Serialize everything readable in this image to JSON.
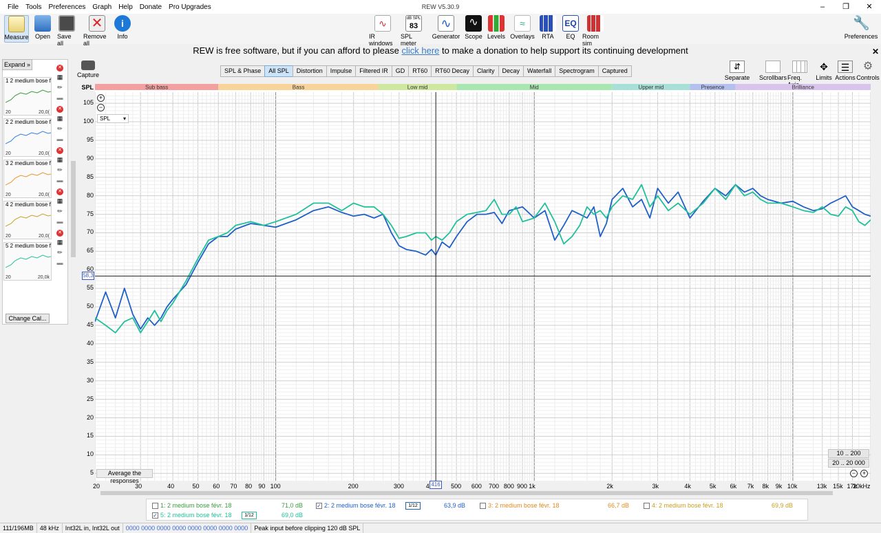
{
  "app": {
    "title": "REW V5.30.9"
  },
  "menu": [
    "File",
    "Tools",
    "Preferences",
    "Graph",
    "Help",
    "Donate",
    "Pro Upgrades"
  ],
  "toolbar_left": [
    {
      "label": "Measure",
      "icon": "measure-icon",
      "active": true
    },
    {
      "label": "Open",
      "icon": "open-folder-icon"
    },
    {
      "label": "Save all",
      "icon": "save-icon"
    },
    {
      "label": "Remove all",
      "icon": "remove-all-icon"
    },
    {
      "label": "Info",
      "icon": "info-icon"
    }
  ],
  "toolbar_center": [
    {
      "label": "IR windows",
      "icon": "ir-windows-icon"
    },
    {
      "label": "SPL meter",
      "icon": "spl-meter-icon",
      "badge_top": "dB SPL",
      "badge_value": "83"
    },
    {
      "label": "Generator",
      "icon": "generator-icon"
    },
    {
      "label": "Scope",
      "icon": "scope-icon"
    },
    {
      "label": "Levels",
      "icon": "levels-icon"
    },
    {
      "label": "Overlays",
      "icon": "overlays-icon"
    },
    {
      "label": "RTA",
      "icon": "rta-icon"
    },
    {
      "label": "EQ",
      "icon": "eq-icon"
    },
    {
      "label": "Room sim",
      "icon": "room-sim-icon"
    }
  ],
  "toolbar_right": {
    "label": "Preferences",
    "icon": "preferences-wrench-icon"
  },
  "donate": {
    "before": "REW is free software, but if you can afford to please ",
    "link": "click here",
    "after": " to make a donation to help support its continuing development"
  },
  "left_panel": {
    "expand_label": "Expand",
    "measurements": [
      {
        "label": "1 2 medium bose f",
        "axis_left": "20",
        "axis_right": "20,0(",
        "color": "#3a9a3a"
      },
      {
        "label": "2 2 medium bose f",
        "axis_left": "20",
        "axis_right": "20,0(",
        "color": "#2f7fe0"
      },
      {
        "label": "3 2 medium bose f",
        "axis_left": "20",
        "axis_right": "20,0(",
        "color": "#e8962c"
      },
      {
        "label": "4 2 medium bose f",
        "axis_left": "20",
        "axis_right": "20,0(",
        "color": "#c8a020"
      },
      {
        "label": "5 2 medium bose f",
        "axis_left": "20",
        "axis_right": "20,0k",
        "color": "#22c29a"
      }
    ],
    "change_cal_label": "Change Cal..."
  },
  "capture": {
    "label": "Capture"
  },
  "graph_tabs": [
    {
      "label": "SPL & Phase"
    },
    {
      "label": "All SPL",
      "selected": true
    },
    {
      "label": "Distortion"
    },
    {
      "label": "Impulse"
    },
    {
      "label": "Filtered IR"
    },
    {
      "label": "GD"
    },
    {
      "label": "RT60"
    },
    {
      "label": "RT60 Decay"
    },
    {
      "label": "Clarity"
    },
    {
      "label": "Decay"
    },
    {
      "label": "Waterfall"
    },
    {
      "label": "Spectrogram"
    },
    {
      "label": "Captured"
    }
  ],
  "right_tools": [
    {
      "label": "Separate",
      "icon": "separate-icon"
    },
    {
      "label": "Scrollbars",
      "icon": "scrollbars-icon"
    },
    {
      "label": "Freq. Axis",
      "icon": "freq-axis-icon"
    },
    {
      "label": "Limits",
      "icon": "limits-icon"
    },
    {
      "label": "Actions",
      "icon": "actions-icon"
    },
    {
      "label": "Controls",
      "icon": "controls-gear-icon"
    }
  ],
  "bands": [
    {
      "label": "Sub bass",
      "color": "#f2a0a0"
    },
    {
      "label": "Bass",
      "color": "#f8d49a"
    },
    {
      "label": "Low mid",
      "color": "#cfe8a0"
    },
    {
      "label": "Mid",
      "color": "#a9e6b0"
    },
    {
      "label": "Upper mid",
      "color": "#a8e0d8"
    },
    {
      "label": "Presence",
      "color": "#b4c0f0"
    },
    {
      "label": "Brilliance",
      "color": "#d8c4ec"
    }
  ],
  "plot": {
    "y_title": "SPL",
    "y_selector": "SPL",
    "cursor_y": "58,3",
    "cursor_x": "416",
    "average_button": "Average the responses",
    "range_buttons": [
      "10 .. 200",
      "20 .. 20 000"
    ]
  },
  "chart_data": {
    "type": "line",
    "xlabel": "",
    "ylabel": "SPL",
    "x_scale": "log",
    "xlim": [
      20,
      20000
    ],
    "ylim": [
      3,
      108
    ],
    "y_ticks": [
      5,
      10,
      15,
      20,
      25,
      30,
      35,
      40,
      45,
      50,
      55,
      60,
      65,
      70,
      75,
      80,
      85,
      90,
      95,
      100,
      105
    ],
    "x_tick_labels": [
      "20",
      "30",
      "40",
      "50",
      "60",
      "70",
      "80",
      "90",
      "100",
      "200",
      "300",
      "400",
      "500",
      "600",
      "700",
      "800",
      "900",
      "1k",
      "2k",
      "3k",
      "4k",
      "5k",
      "6k",
      "7k",
      "8k",
      "9k",
      "10k",
      "13k",
      "15k",
      "17k",
      "20kHz"
    ],
    "x_tick_values": [
      20,
      30,
      40,
      50,
      60,
      70,
      80,
      90,
      100,
      200,
      300,
      400,
      500,
      600,
      700,
      800,
      900,
      1000,
      2000,
      3000,
      4000,
      5000,
      6000,
      7000,
      8000,
      9000,
      10000,
      13000,
      15000,
      17000,
      20000
    ],
    "cursor": {
      "x": 416,
      "y": 58.3
    },
    "grid": true,
    "series": [
      {
        "name": "2: 2 medium bose févr. 18",
        "color": "#1f5fc8",
        "x": [
          20,
          22,
          24,
          26,
          28,
          30,
          32,
          34,
          36,
          38,
          40,
          45,
          50,
          55,
          60,
          65,
          70,
          80,
          90,
          100,
          120,
          140,
          160,
          180,
          200,
          220,
          240,
          260,
          280,
          300,
          320,
          350,
          380,
          400,
          416,
          440,
          470,
          500,
          550,
          600,
          650,
          700,
          750,
          800,
          850,
          900,
          1000,
          1100,
          1200,
          1300,
          1400,
          1500,
          1600,
          1700,
          1800,
          1900,
          2000,
          2200,
          2400,
          2600,
          2800,
          3000,
          3300,
          3600,
          4000,
          4500,
          5000,
          5500,
          6000,
          6500,
          7000,
          7500,
          8000,
          9000,
          10000,
          11000,
          12000,
          13000,
          14000,
          15000,
          16000,
          17000,
          18000,
          19000,
          20000
        ],
        "y": [
          46,
          54,
          47,
          55,
          48,
          44,
          47,
          45,
          47,
          50,
          52,
          56,
          62,
          67,
          69,
          69,
          71,
          72.5,
          72,
          71.5,
          73.5,
          76,
          77,
          75.5,
          74.5,
          75,
          74,
          75,
          70,
          66.5,
          65.5,
          65,
          64,
          65.5,
          64,
          67.5,
          66,
          69,
          73,
          75,
          75,
          75.5,
          72.5,
          76,
          76.5,
          77,
          74,
          76,
          68,
          72,
          76,
          75,
          74,
          77,
          69,
          72.5,
          79,
          82,
          77,
          79,
          74,
          82,
          78,
          81,
          74,
          78.5,
          82,
          80,
          83,
          81,
          82,
          80,
          79,
          78,
          78.5,
          77,
          76,
          76.5,
          78,
          79,
          80,
          77,
          76,
          75,
          74.5
        ]
      },
      {
        "name": "5: 2 medium bose févr. 18",
        "color": "#20c09a",
        "x": [
          20,
          22,
          24,
          26,
          28,
          30,
          32,
          34,
          36,
          38,
          40,
          45,
          50,
          55,
          60,
          65,
          70,
          80,
          90,
          100,
          120,
          140,
          160,
          180,
          200,
          220,
          240,
          260,
          280,
          300,
          320,
          350,
          380,
          400,
          416,
          440,
          470,
          500,
          550,
          600,
          650,
          700,
          750,
          800,
          850,
          900,
          1000,
          1100,
          1200,
          1300,
          1400,
          1500,
          1600,
          1700,
          1800,
          1900,
          2000,
          2200,
          2400,
          2600,
          2800,
          3000,
          3300,
          3600,
          4000,
          4500,
          5000,
          5500,
          6000,
          6500,
          7000,
          7500,
          8000,
          9000,
          10000,
          11000,
          12000,
          13000,
          14000,
          15000,
          16000,
          17000,
          18000,
          19000,
          20000
        ],
        "y": [
          47,
          45,
          43,
          46,
          47,
          43,
          46,
          49,
          46,
          49,
          51,
          57,
          63,
          68,
          69,
          70,
          72,
          73,
          72,
          73,
          75,
          78,
          78,
          76,
          78,
          77,
          77,
          75,
          72,
          68.5,
          69,
          70,
          70,
          68,
          69,
          68,
          70,
          73,
          75,
          75.5,
          76,
          79,
          75,
          75,
          77,
          73,
          74,
          78,
          73,
          67,
          69,
          72,
          77,
          75,
          76,
          74,
          77,
          80,
          79,
          83,
          77,
          80,
          76,
          78,
          75,
          78,
          82,
          79,
          83,
          80,
          81,
          79,
          78,
          78,
          77,
          76,
          75.5,
          77,
          75,
          74.5,
          77,
          76,
          73,
          72,
          73.5
        ]
      }
    ]
  },
  "legend": [
    {
      "label": "1: 2 medium bose févr. 18",
      "value": "71,0 dB",
      "checked": false,
      "color": "#3a9a3a"
    },
    {
      "label": "2: 2 medium bose févr. 18",
      "value": "63,9 dB",
      "checked": true,
      "color": "#1f5fc8",
      "smoothing": "1/12"
    },
    {
      "label": "3: 2 medium bose févr. 18",
      "value": "66,7 dB",
      "checked": false,
      "color": "#e08a20"
    },
    {
      "label": "4: 2 medium bose févr. 18",
      "value": "69,9 dB",
      "checked": false,
      "color": "#c8a020"
    },
    {
      "label": "5: 2 medium bose févr. 18",
      "value": "69,0 dB",
      "checked": true,
      "color": "#20c09a",
      "smoothing": "1/12"
    }
  ],
  "status": [
    "111/196MB",
    "48 kHz",
    "Int32L in, Int32L out",
    "0000 0000  0000 0000  0000 0000  0000 0000",
    "Peak input before clipping 120 dB SPL"
  ]
}
